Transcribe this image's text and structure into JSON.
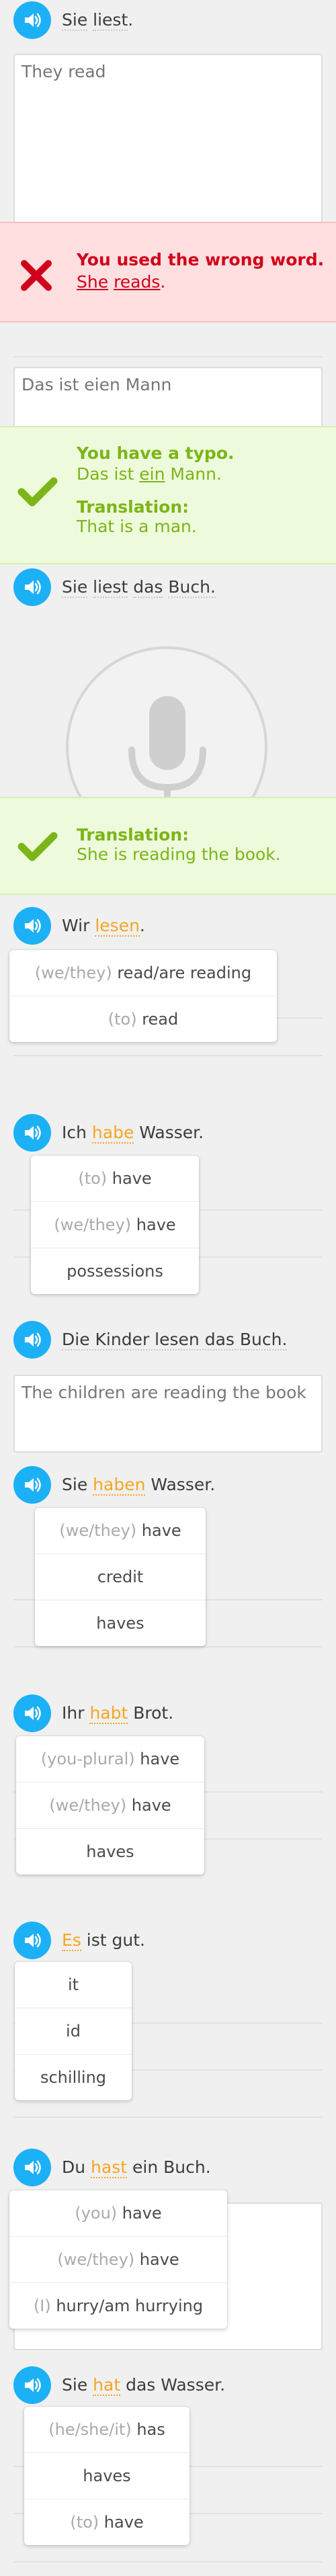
{
  "colors": {
    "speaker": "#1cb0f6",
    "highlight": "#f5a623",
    "wrong": "#d0021b",
    "right": "#7cb518",
    "wrong_bg": "#ffdfe0",
    "right_bg": "#eefadc"
  },
  "exercises": [
    {
      "prompt": {
        "before": "",
        "words": [
          "Sie",
          "liest"
        ],
        "after": "."
      },
      "answer": "They read"
    },
    {
      "banner": {
        "title": "You used the wrong word.",
        "word1": "She",
        "word2": "reads",
        "end": "."
      }
    },
    {
      "answer": "Das ist eien Mann"
    },
    {
      "banner": {
        "title": "You have a typo.",
        "line_a": "Das ist ",
        "line_u": "ein",
        "line_b": " Mann.",
        "trans_label": "Translation:",
        "trans_text": "That is a man."
      }
    },
    {
      "prompt": {
        "words": [
          "Sie",
          "liest",
          "das",
          "Buch."
        ]
      }
    },
    {
      "banner": {
        "trans_label": "Translation:",
        "trans_text": "She is reading the book."
      }
    },
    {
      "prompt": {
        "before": "Wir ",
        "hl": "lesen",
        "after": "."
      },
      "hints": [
        {
          "pr": "(we/they)",
          "txt": " read/are reading"
        },
        {
          "pr": "(to)",
          "txt": " read"
        }
      ]
    },
    {
      "prompt": {
        "before": "Ich ",
        "hl": "habe",
        "after": " Wasser."
      },
      "hints": [
        {
          "pr": "(to)",
          "txt": " have"
        },
        {
          "pr": "(we/they)",
          "txt": " have"
        },
        {
          "pr": "",
          "txt": "possessions"
        }
      ]
    },
    {
      "prompt": {
        "text": "Die Kinder lesen das Buch."
      },
      "answer": "The children are reading the book"
    },
    {
      "prompt": {
        "before": "Sie ",
        "hl": "haben",
        "after": " Wasser."
      },
      "hints": [
        {
          "pr": "(we/they)",
          "txt": " have"
        },
        {
          "pr": "",
          "txt": "credit"
        },
        {
          "pr": "",
          "txt": "haves"
        }
      ]
    },
    {
      "prompt": {
        "before": "Ihr ",
        "hl": "habt",
        "after": " Brot."
      },
      "hints": [
        {
          "pr": "(you-plural)",
          "txt": " have"
        },
        {
          "pr": "(we/they)",
          "txt": " have"
        },
        {
          "pr": "",
          "txt": "haves"
        }
      ]
    },
    {
      "prompt": {
        "before": "",
        "hl": "Es",
        "after": " ist gut."
      },
      "hints": [
        {
          "pr": "",
          "txt": "it"
        },
        {
          "pr": "",
          "txt": "id"
        },
        {
          "pr": "",
          "txt": "schilling"
        }
      ]
    },
    {
      "prompt": {
        "before": "Du ",
        "hl": "hast",
        "after": " ein Buch."
      },
      "hints": [
        {
          "pr": "(you)",
          "txt": " have"
        },
        {
          "pr": "(we/they)",
          "txt": " have"
        },
        {
          "pr": "(I)",
          "txt": " hurry/am hurrying"
        }
      ]
    },
    {
      "prompt": {
        "before": "Sie ",
        "hl": "hat",
        "after": " das Wasser."
      },
      "hints": [
        {
          "pr": "(he/she/it)",
          "txt": " has"
        },
        {
          "pr": "",
          "txt": "haves"
        },
        {
          "pr": "(to)",
          "txt": " have"
        }
      ]
    }
  ]
}
